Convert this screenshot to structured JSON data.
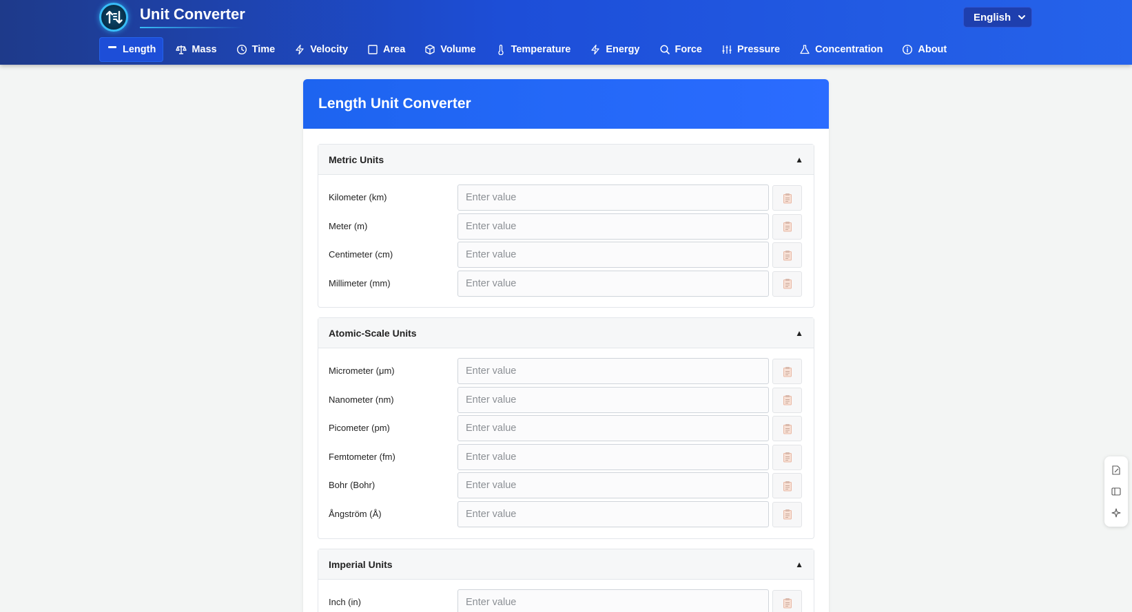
{
  "app": {
    "title": "Unit Converter",
    "language": "English"
  },
  "nav": [
    {
      "label": "Length",
      "icon": "length-icon",
      "active": true
    },
    {
      "label": "Mass",
      "icon": "scale-icon"
    },
    {
      "label": "Time",
      "icon": "clock-icon"
    },
    {
      "label": "Velocity",
      "icon": "bolt-icon"
    },
    {
      "label": "Area",
      "icon": "square-icon"
    },
    {
      "label": "Volume",
      "icon": "cube-icon"
    },
    {
      "label": "Temperature",
      "icon": "thermometer-icon"
    },
    {
      "label": "Energy",
      "icon": "bolt-icon"
    },
    {
      "label": "Force",
      "icon": "search-icon"
    },
    {
      "label": "Pressure",
      "icon": "sliders-icon"
    },
    {
      "label": "Concentration",
      "icon": "flask-icon"
    },
    {
      "label": "About",
      "icon": "info-icon"
    }
  ],
  "converter": {
    "title": "Length Unit Converter",
    "placeholder": "Enter value",
    "sections": [
      {
        "title": "Metric Units",
        "toggle": "▲",
        "units": [
          "Kilometer (km)",
          "Meter (m)",
          "Centimeter (cm)",
          "Millimeter (mm)"
        ]
      },
      {
        "title": "Atomic-Scale Units",
        "toggle": "▲",
        "units": [
          "Micrometer (μm)",
          "Nanometer (nm)",
          "Picometer (pm)",
          "Femtometer (fm)",
          "Bohr (Bohr)",
          "Ångström (Å)"
        ]
      },
      {
        "title": "Imperial Units",
        "toggle": "▲",
        "units": [
          "Inch (in)"
        ]
      }
    ]
  },
  "colors": {
    "header_start": "#1e3a8a",
    "header_end": "#2563eb",
    "card_header": "#1d64f0",
    "logo_ring": "#38bdf8"
  },
  "side_tools": [
    "edit-icon",
    "sidebar-icon",
    "sparkle-icon"
  ]
}
